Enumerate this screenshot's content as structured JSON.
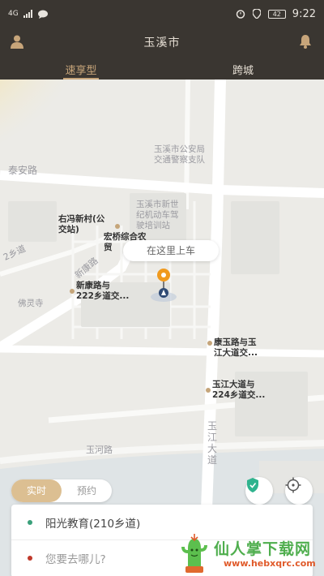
{
  "statusbar": {
    "signal": "4G",
    "time": "9:22",
    "battery": "42"
  },
  "header": {
    "title": "玉溪市",
    "tabs": [
      {
        "label": "速享型",
        "active": true
      },
      {
        "label": "跨城",
        "active": false
      }
    ]
  },
  "map": {
    "labels": {
      "police": "玉溪市公安局\n交通警察支队",
      "taian": "泰安路",
      "youfeng": "右冯新村(公\n交站)",
      "hongqiao": "宏桥综合农\n贸",
      "school": "玉溪市新世\n纪机动车驾\n驶培训站",
      "road2": "2乡道",
      "xinkang_road": "新康路",
      "xinkang_junction": "新康路与\n222乡道交...",
      "fosi": "佛灵寺",
      "kangyu": "康玉路与玉\n江大道交...",
      "yujiang224": "玉江大道与\n224乡道交...",
      "yujiang_avenue": "玉江\n大道",
      "yuhe": "玉河路"
    },
    "pickup_label": "在这里上车"
  },
  "mode": {
    "realtime": "实时",
    "reserve": "预约"
  },
  "trip": {
    "origin": "阳光教育(210乡道)",
    "destination_placeholder": "您要去哪儿?"
  },
  "colors": {
    "accent": "#c7a57a",
    "header_bg": "#3a3631",
    "origin_dot": "#3aa07a",
    "dest_dot": "#c0392b"
  },
  "watermark": {
    "name": "仙人掌下载网",
    "url": "www.hebxqrc.com"
  }
}
